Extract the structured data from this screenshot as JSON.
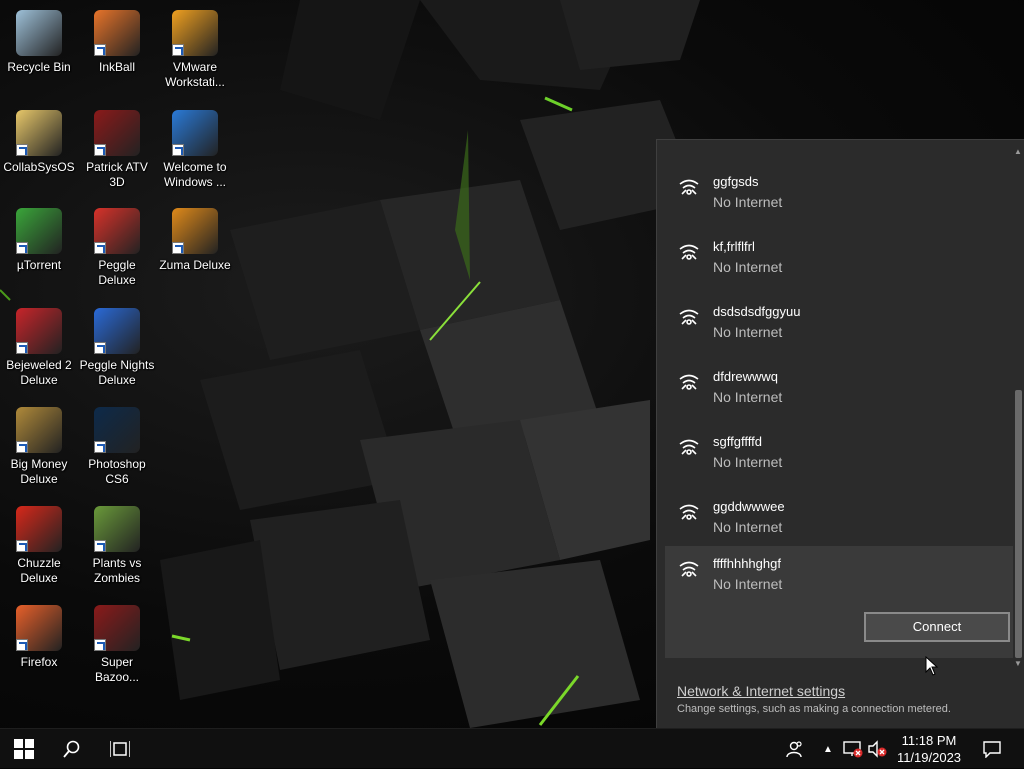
{
  "desktop": {
    "icons": [
      {
        "label": "Recycle Bin",
        "icon": "recycle-bin-icon",
        "color": "#9ec1d9"
      },
      {
        "label": "InkBall",
        "icon": "inkball-icon",
        "color": "#e8742a"
      },
      {
        "label": "VMware Workstati...",
        "icon": "vmware-icon",
        "color": "#f0a020"
      },
      {
        "label": "CollabSysOS",
        "icon": "folder-icon",
        "color": "#e8c86a"
      },
      {
        "label": "Patrick ATV 3D",
        "icon": "flash-icon",
        "color": "#8b1a1a"
      },
      {
        "label": "Welcome to Windows ...",
        "icon": "windows-orb-icon",
        "color": "#2a7ad8"
      },
      {
        "label": "µTorrent",
        "icon": "utorrent-icon",
        "color": "#3aa63a"
      },
      {
        "label": "Peggle Deluxe",
        "icon": "peggle-icon",
        "color": "#d8322a"
      },
      {
        "label": "Zuma Deluxe",
        "icon": "zuma-icon",
        "color": "#e08a1a"
      },
      {
        "label": "Bejeweled 2 Deluxe",
        "icon": "bejeweled-icon",
        "color": "#c8242a"
      },
      {
        "label": "Peggle Nights Deluxe",
        "icon": "peggle-nights-icon",
        "color": "#2a6ad8"
      },
      {
        "label": "Big Money Deluxe",
        "icon": "money-bag-icon",
        "color": "#b08a3a"
      },
      {
        "label": "Photoshop CS6",
        "icon": "photoshop-icon",
        "color": "#0d2a4a"
      },
      {
        "label": "Chuzzle Deluxe",
        "icon": "chuzzle-icon",
        "color": "#d8281a"
      },
      {
        "label": "Plants vs Zombies",
        "icon": "pvz-icon",
        "color": "#6a9a3a"
      },
      {
        "label": "Firefox",
        "icon": "firefox-icon",
        "color": "#e8602a"
      },
      {
        "label": "Super Bazoo...",
        "icon": "flash-icon",
        "color": "#8b1a1a"
      }
    ]
  },
  "network_flyout": {
    "networks": [
      {
        "name": "ggfgsds",
        "status": "No Internet"
      },
      {
        "name": "kf,frlflfrl",
        "status": "No Internet"
      },
      {
        "name": "dsdsdsdfggyuu",
        "status": "No Internet"
      },
      {
        "name": "dfdrewwwq",
        "status": "No Internet"
      },
      {
        "name": "sgffgffffd",
        "status": "No Internet"
      },
      {
        "name": "ggddwwwee",
        "status": "No Internet"
      },
      {
        "name": "ffffhhhhghgf",
        "status": "No Internet",
        "selected": true
      }
    ],
    "connect_label": "Connect",
    "settings_link": "Network & Internet settings",
    "settings_desc": "Change settings, such as making a connection metered."
  },
  "taskbar": {
    "time": "11:18 PM",
    "date": "11/19/2023"
  }
}
